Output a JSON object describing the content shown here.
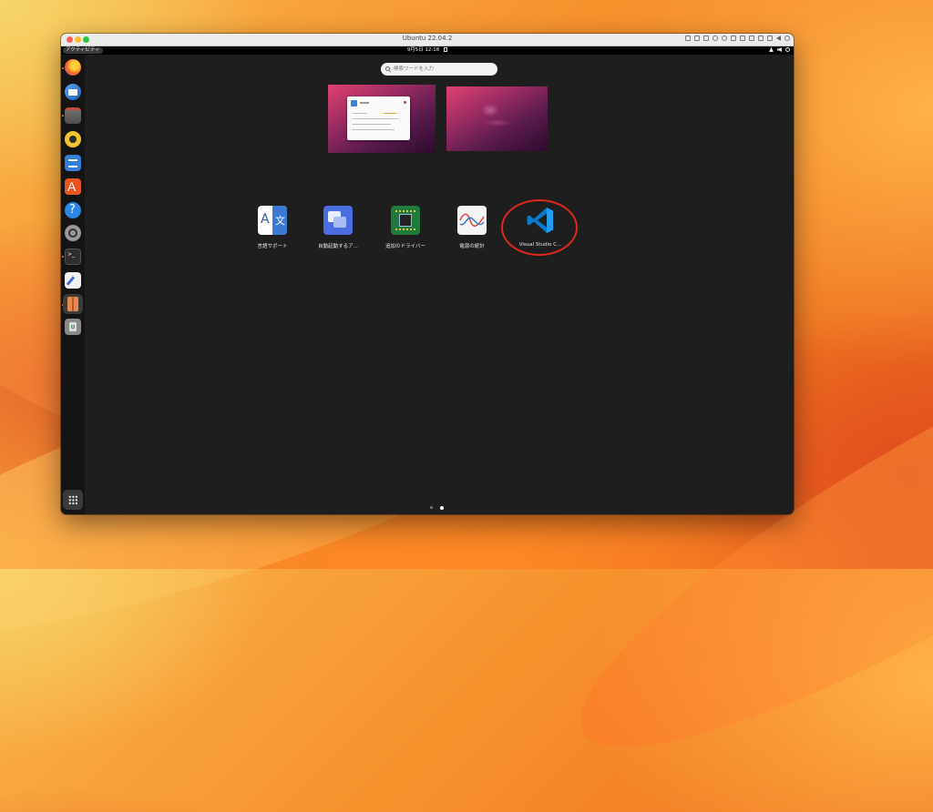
{
  "window": {
    "title": "Ubuntu 22.04.2"
  },
  "topbar": {
    "activities": "アクティビティ",
    "clock": "9月5日  12:18"
  },
  "search": {
    "placeholder": "検索ワードを入力"
  },
  "dock": {
    "items": [
      {
        "name": "firefox-icon",
        "running": true
      },
      {
        "name": "thunderbird-icon",
        "running": false
      },
      {
        "name": "files-icon",
        "running": true
      },
      {
        "name": "rhythmbox-icon",
        "running": false
      },
      {
        "name": "libreoffice-writer-icon",
        "running": false
      },
      {
        "name": "ubuntu-software-icon",
        "running": false
      },
      {
        "name": "help-icon",
        "running": false
      },
      {
        "name": "settings-icon",
        "running": false
      },
      {
        "name": "terminal-icon",
        "running": true
      },
      {
        "name": "text-editor-icon",
        "running": false
      },
      {
        "name": "archive-manager-icon",
        "running": true
      },
      {
        "name": "trash-icon",
        "running": false
      }
    ]
  },
  "apps": [
    {
      "label": "言語サポート",
      "icon": "language-support-icon"
    },
    {
      "label": "自動起動するア...",
      "icon": "startup-applications-icon"
    },
    {
      "label": "追加のドライバー",
      "icon": "additional-drivers-icon"
    },
    {
      "label": "電源の統計",
      "icon": "power-statistics-icon"
    },
    {
      "label": "Visual Studio C...",
      "icon": "vscode-icon"
    }
  ],
  "pagination": {
    "current_page": 2,
    "total_pages": 2
  },
  "colors": {
    "highlight_ring": "#e0291b",
    "vscode_blue": "#0a7acc",
    "overview_bg": "#1e1e1e"
  }
}
